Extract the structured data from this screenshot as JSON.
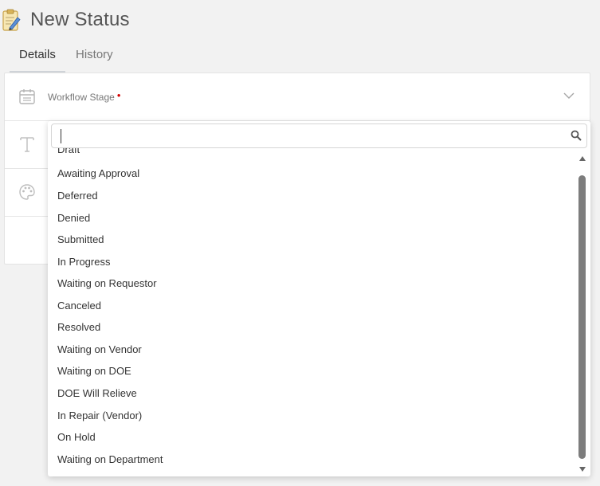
{
  "header": {
    "title": "New Status",
    "icon": "clipboard-edit-icon"
  },
  "tabs": [
    {
      "label": "Details",
      "active": true
    },
    {
      "label": "History",
      "active": false
    }
  ],
  "form": {
    "workflow_stage": {
      "label": "Workflow Stage",
      "required_marker": "•"
    }
  },
  "dropdown": {
    "search_value": "",
    "items": [
      "Draft",
      "Awaiting Approval",
      "Deferred",
      "Denied",
      "Submitted",
      "In Progress",
      "Waiting on Requestor",
      "Canceled",
      "Resolved",
      "Waiting on Vendor",
      "Waiting on DOE",
      "DOE Will Relieve",
      "In Repair (Vendor)",
      "On Hold",
      "Waiting on Department"
    ]
  },
  "colors": {
    "background": "#f2f2f2",
    "required": "#d40000",
    "scroll_thumb": "#7d7d7d"
  }
}
